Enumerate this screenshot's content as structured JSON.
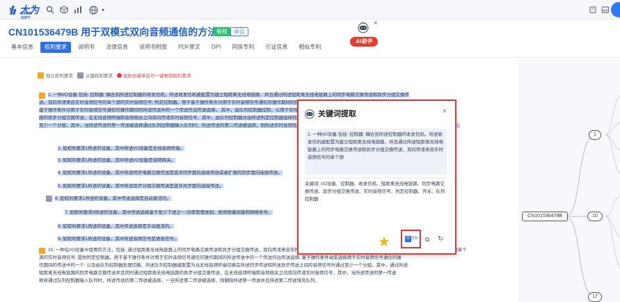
{
  "toolbar": {
    "logo_text": "大为",
    "logo_sub": "DAWEI SOFT",
    "icons": [
      "search-icon",
      "cube-icon",
      "chart-icon",
      "globe-icon"
    ],
    "right_icons": [
      "pin-icon",
      "bookmark-icon"
    ]
  },
  "header": {
    "title": "CN101536479B 用于双模式双向音频通信的方法和设备",
    "badge_valid": "有权",
    "badge_lost": "诉讼"
  },
  "tabs": [
    {
      "label": "基本信息",
      "active": false
    },
    {
      "label": "权利要求",
      "active": true
    },
    {
      "label": "说明书",
      "active": false
    },
    {
      "label": "法律信息",
      "active": false
    },
    {
      "label": "说明书附图",
      "active": false
    },
    {
      "label": "PDF原文",
      "active": false
    },
    {
      "label": "DPI",
      "active": false
    },
    {
      "label": "同族专利",
      "active": false
    },
    {
      "label": "引证信息",
      "active": false
    },
    {
      "label": "相似专利",
      "active": false
    }
  ],
  "ai_helper": {
    "label": "AI助手",
    "close": "×"
  },
  "legend": {
    "independent": "独立权利要求",
    "dependent": "从属权利要求",
    "hint": "鼠标右键单击可一键复制权利要求"
  },
  "claims": {
    "c1_lines": [
      "1. 一种I/O设备,包括: 控制器; 耦合到所述控制器的收发信机，所述收发信机被配置为建立短距离无线电链路，并且通过所述短距离无线电链路上的同步电路交换传送和异步分组交换传",
      "送。双向传递来自实时音频信号的单个源的实时音频信号; 判定控制器，用于基于操作条件对用于实时音频信号通信的操作期间的所述传送中的一个传送作出选择; 开关，其中所述收发信机，以及 开关，用于",
      "基于操作条件对用于实时音频信号通信的操作期间的所述传送中的一个传送作出传送选择， 其中，由队列控制器控制，以用于实时音频信号的传送，在所述异步分组交换传送，其中，通过所述短距离无线电链",
      "路的异步分组交换传送，在无线音频终端和音频网关之间双向传递实时音频信号，其中，由队列控制器对由所述判定控制器选择的音频信号进行排队，所述音频在所述异步分组交换传送链路之间的传输之间通过",
      "至少一个分组，其中，当所述传送的第一传送被选择通过队列控制器输入队列时，所述传送的第二传送被选择，则所述实时音频信号在所述第一传送和所述第二传送之间切换，或者使其中所述第二传送填充队列。"
    ],
    "dep": [
      "2. 如权利要求1所述的设备，其中所述I/O设备是无线音频终端。",
      "3. 如权利要求1所述的设备，其中所述I/O设备是音频网关。",
      "4. 如权利要求1所述的设备，其中所述同步电路交换传送是蓝牙同步面向连接传送或者扩展的同步面向连接传送。",
      "5. 如权利要求1所述的设备，其中所述异步分组交换传送是蓝牙异步面向连接传送。",
      "6. 如权利要求1所述的设备，其中传送选择是自动激活的。",
      "7. 如权利要求6所述的设备，其中传送选择基于至少下述之一:功率管理准则、射频质量测量和网络条件。",
      "8. 如权利要求1所述的设备，其中传送选择是手动激活的。",
      "9. 如权利要求1所述的设备，其中所述音频信号是语音信号。"
    ],
    "c10_lines": [
      "10. 一种在I/O设备中使用的方法，包括: 通过短距离无线电链路上的同步电路交换传送和异步分组交换传送，双向传递来自实时音频信号的单个源的实时音频信号，以及基于操作条件，对用于实时音频信号的单个",
      "源的实时音频信号; 提供判定控制器，用于基于操作条件对用于实时音频信号通信的操作期间的所述传送中的一个传送作出传送选择; 基于操作条件动态选择用于实时音频信号通信的操",
      "作期间的传送中的一个; 以及由队列控制器处理切换。所述队列控制器被配置为当无线音频终端切换在所述同步传送和所述异步传送之间的音频信号时通过至少一个分组，其中，通过所述",
      "短距离无线电链路的同步电路交换传送并且同时通过短距离无线电链路的异步分组交换传送，在无线音频终端和音频网关之间双向传递实时音频信号，其中，当所述传送的第一传送",
      "继续通过队列控制器输入队列时，所述传送的第二传送被选择，一旦所述第二传送被选择，则删除所述第一传送并且所述第二传送填充队列。"
    ]
  },
  "mindmap": {
    "root": "CN101536479B",
    "nodes": [
      "1",
      "10",
      "17"
    ]
  },
  "dialog": {
    "title": "关键词提取",
    "close": "×",
    "text": "1. 一种I/O设备,包括: 控制器; 耦合到所述控制器的收发信机。所述收发信机被配置为建立短距离无线电链路，并且通过所述短距离无线电链路上的同步电路交换传送和异步分组交换传送，双向传递来自实时音频信号的单个源",
    "keywords": "关键词: I/O设备、控制器、收发信机、短距离无线电链路、同步电路交换传送、异步分组交换传送、实时音频信号、判定控制器、开关、队列控制器",
    "lang_label": "EN",
    "lang_icon": "中"
  }
}
